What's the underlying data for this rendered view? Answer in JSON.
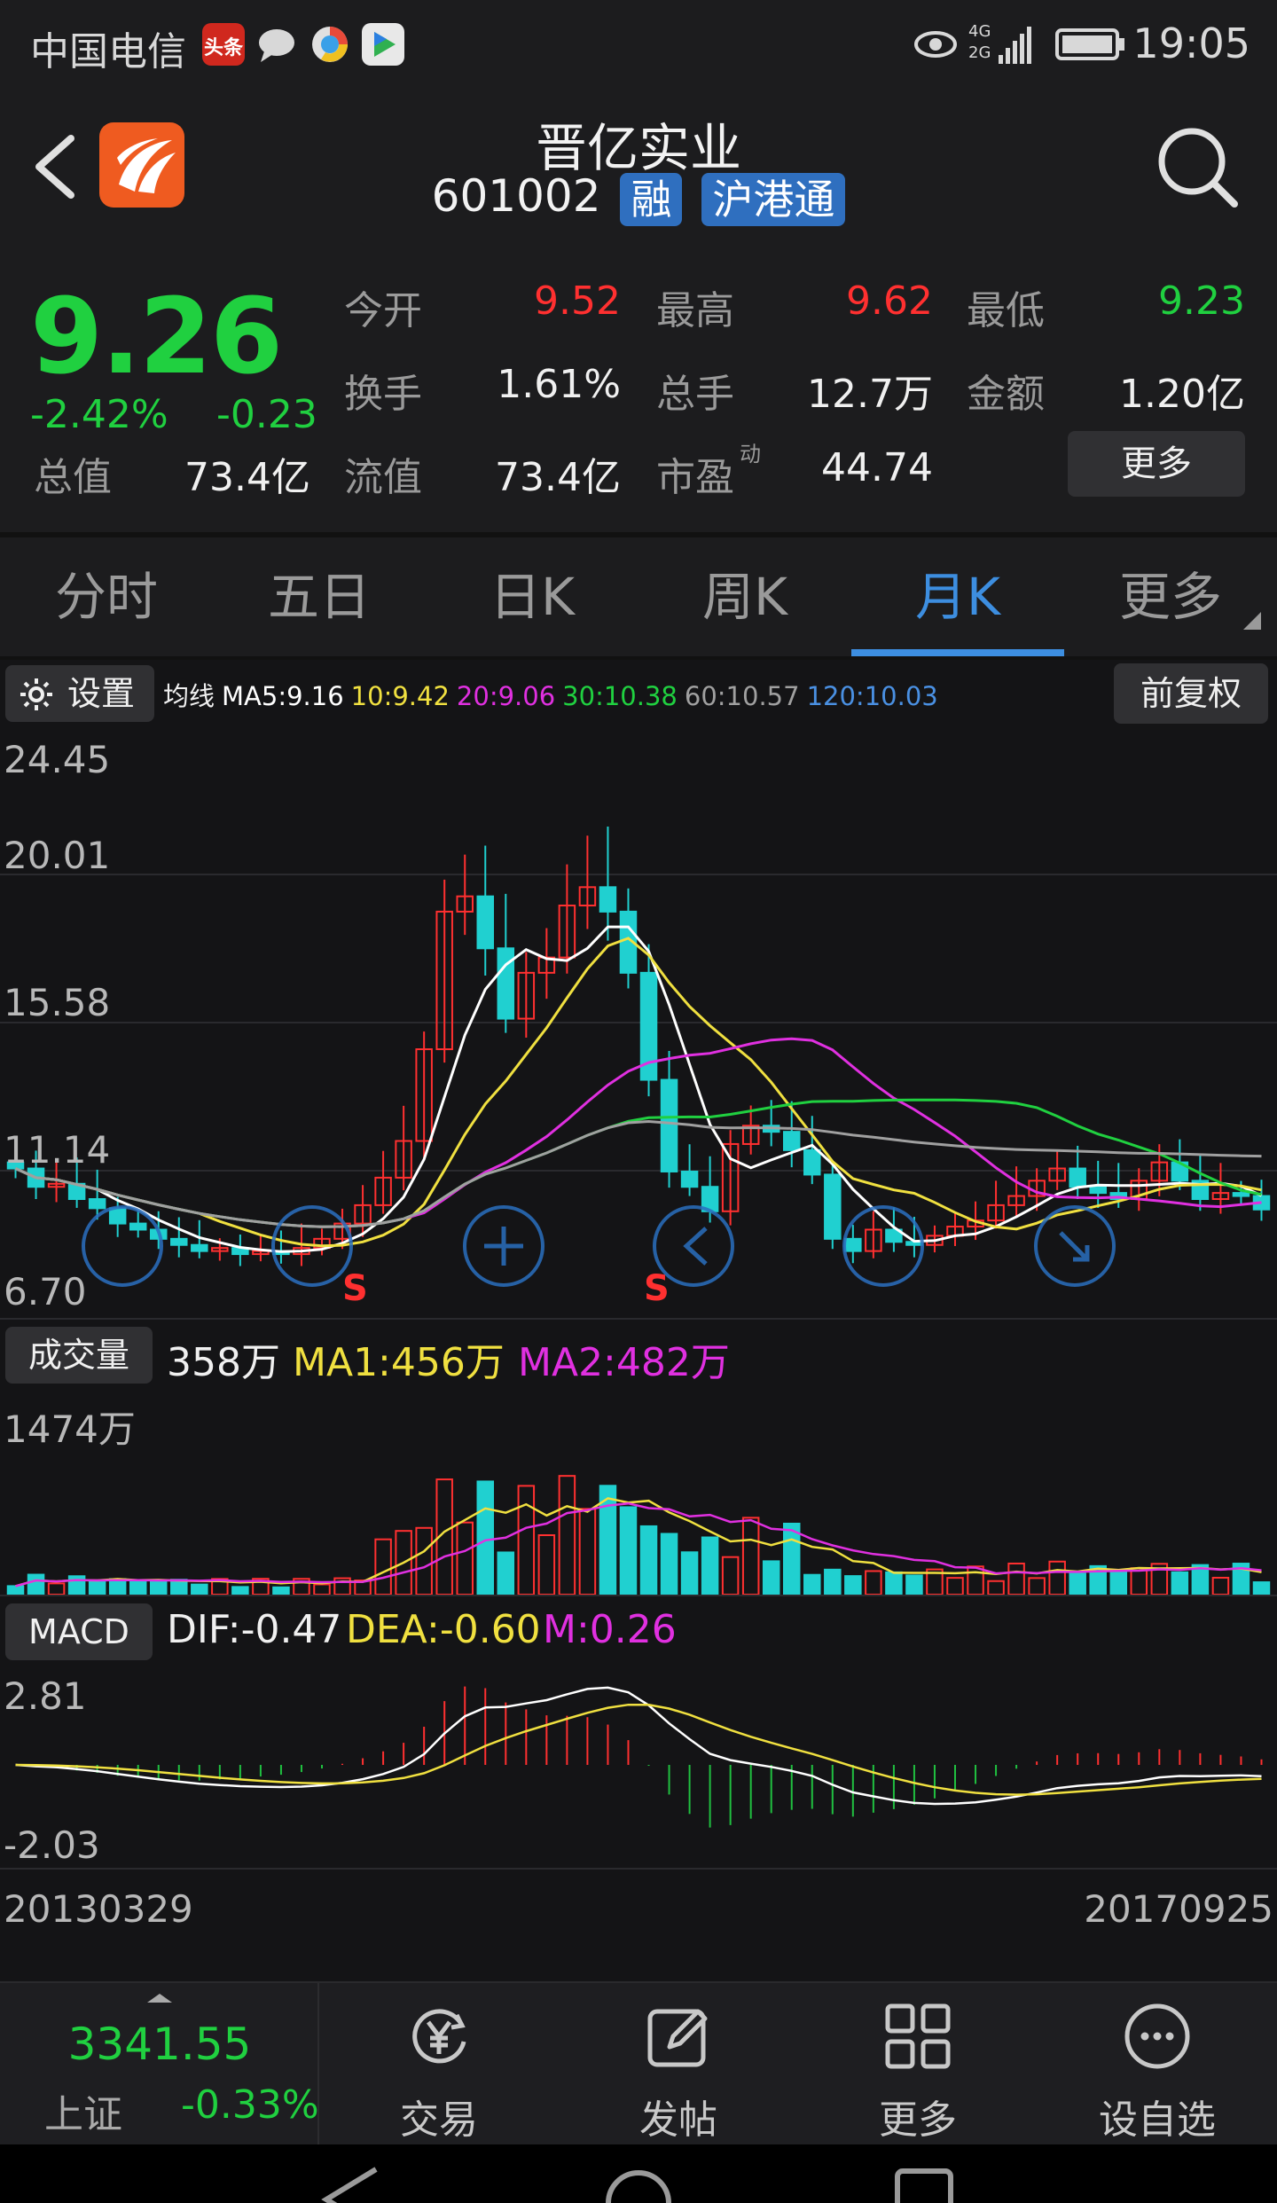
{
  "status_bar": {
    "carrier": "中国电信",
    "toutiao_label": "头条",
    "time": "19:05",
    "network": "4G 2G"
  },
  "header": {
    "stock_name": "晋亿实业",
    "stock_code": "601002",
    "badge_margin": "融",
    "badge_hk": "沪港通"
  },
  "quote": {
    "price": "9.26",
    "change_pct": "-2.42%",
    "change": "-0.23",
    "fields": [
      {
        "label": "今开",
        "value": "9.52",
        "color": "red"
      },
      {
        "label": "最高",
        "value": "9.62",
        "color": "red"
      },
      {
        "label": "最低",
        "value": "9.23",
        "color": "green"
      },
      {
        "label": "换手",
        "value": "1.61%",
        "color": "white"
      },
      {
        "label": "总手",
        "value": "12.7万",
        "color": "white"
      },
      {
        "label": "金额",
        "value": "1.20亿",
        "color": "white"
      },
      {
        "label": "总值",
        "value": "73.4亿",
        "color": "white"
      },
      {
        "label": "流值",
        "value": "73.4亿",
        "color": "white"
      },
      {
        "label": "市盈",
        "value": "44.74",
        "color": "white"
      }
    ],
    "pe_superscript": "动",
    "more_label": "更多"
  },
  "tabs": [
    {
      "label": "分时"
    },
    {
      "label": "五日"
    },
    {
      "label": "日K"
    },
    {
      "label": "周K"
    },
    {
      "label": "月K",
      "active": true
    },
    {
      "label": "更多"
    }
  ],
  "ma_bar": {
    "settings_label": "设置",
    "prefix": "均线",
    "ma5": "MA5:9.16",
    "ma10": "10:9.42",
    "ma20": "20:9.06",
    "ma30": "30:10.38",
    "ma60": "60:10.57",
    "ma120": "120:10.03",
    "fuquan_label": "前复权",
    "colors": {
      "ma5": "#ffffff",
      "ma10": "#f0e040",
      "ma20": "#e030e0",
      "ma30": "#20d040",
      "ma60": "#a0a0a0",
      "ma120": "#4a90e2"
    }
  },
  "kline": {
    "y_labels": [
      "24.45",
      "20.01",
      "15.58",
      "11.14",
      "6.70"
    ],
    "signal_label": "S"
  },
  "volume": {
    "button_label": "成交量",
    "current": "358万",
    "ma1": "MA1:456万",
    "ma2": "MA2:482万",
    "y_label": "1474万"
  },
  "macd": {
    "button_label": "MACD",
    "dif": "DIF:-0.47",
    "dea": "DEA:-0.60",
    "m": "M:0.26",
    "y_top": "2.81",
    "y_bottom": "-2.03"
  },
  "dates": {
    "start": "20130329",
    "end": "20170925"
  },
  "bottom_bar": {
    "index_value": "3341.55",
    "index_name": "上证",
    "index_change": "-0.33%",
    "items": [
      {
        "label": "交易"
      },
      {
        "label": "发帖"
      },
      {
        "label": "更多"
      },
      {
        "label": "设自选"
      }
    ]
  },
  "colors": {
    "up": "#ff3030",
    "down": "#20d0d0",
    "price_down": "#20d040",
    "accent": "#3d8ee0"
  }
}
